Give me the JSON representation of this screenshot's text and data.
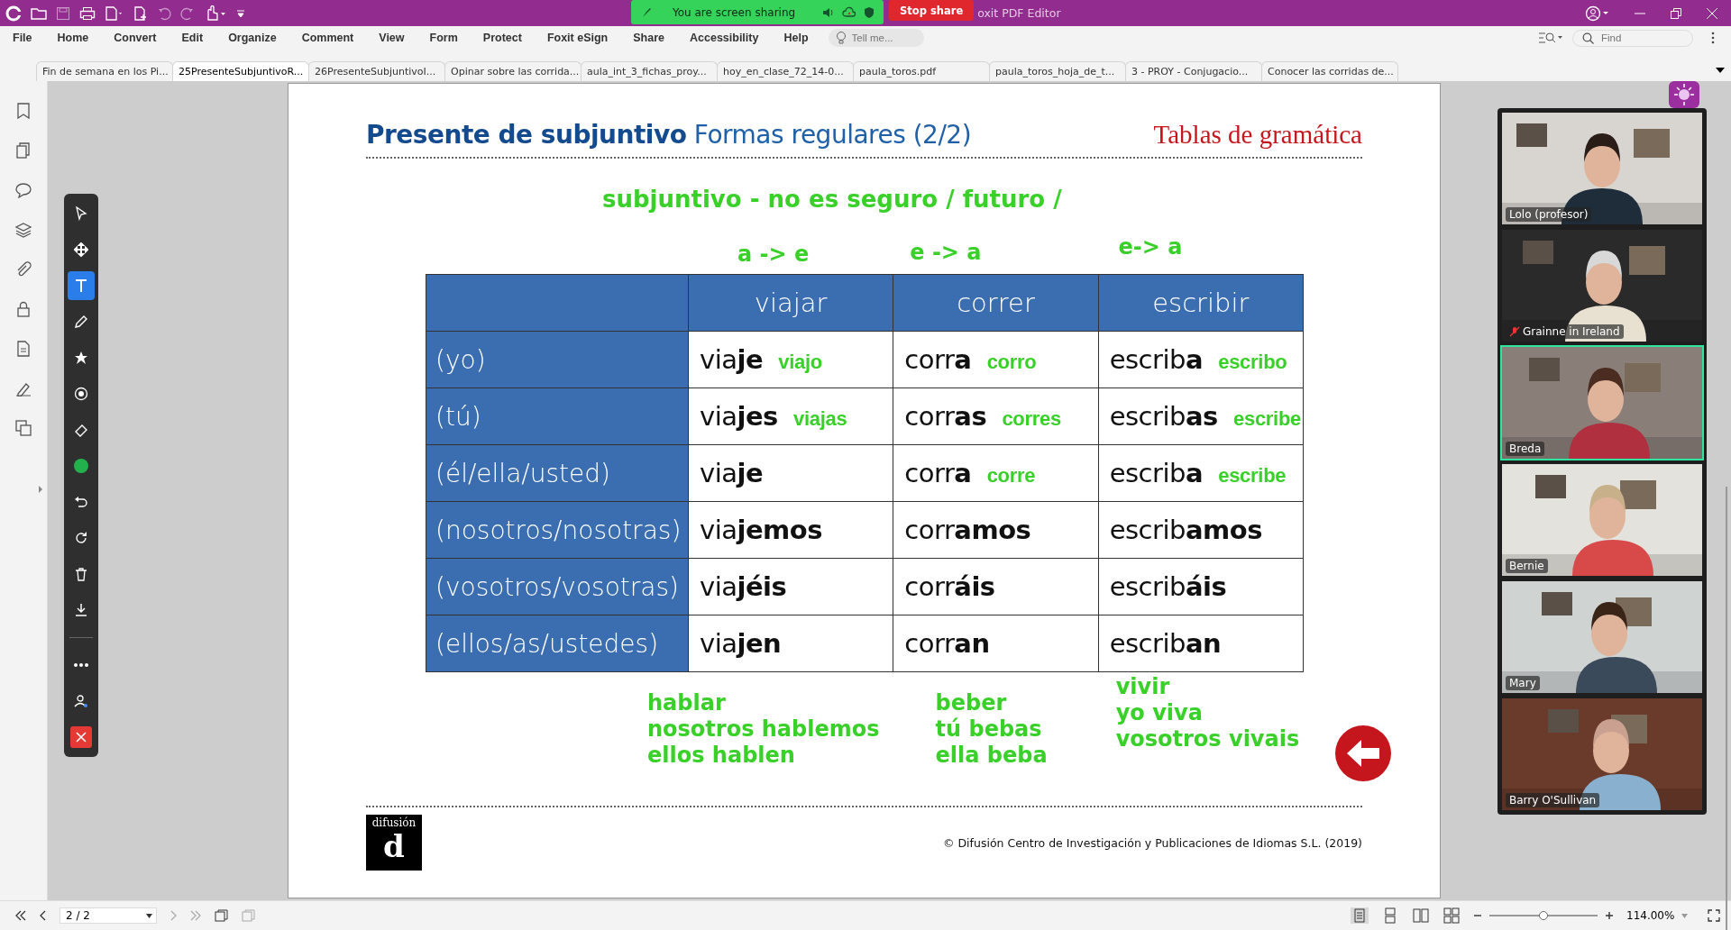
{
  "title_bar": {
    "sharing_status": "You are screen sharing",
    "stop_button": "Stop share",
    "app_title": "oxit PDF Editor"
  },
  "menu": [
    "File",
    "Home",
    "Convert",
    "Edit",
    "Organize",
    "Comment",
    "View",
    "Form",
    "Protect",
    "Foxit eSign",
    "Share",
    "Accessibility",
    "Help"
  ],
  "tell_me": {
    "placeholder": "Tell me..."
  },
  "find": {
    "placeholder": "Find"
  },
  "tabs": [
    {
      "label": "Fin de semana en los Pi...",
      "selected": false
    },
    {
      "label": "25PresenteSubjuntivoR...",
      "selected": true
    },
    {
      "label": "26PresenteSubjuntivoI...",
      "selected": false
    },
    {
      "label": "Opinar sobre las corrida...",
      "selected": false
    },
    {
      "label": "aula_int_3_fichas_proy...",
      "selected": false
    },
    {
      "label": "hoy_en_clase_72_14-0...",
      "selected": false
    },
    {
      "label": "paula_toros.pdf",
      "selected": false
    },
    {
      "label": "paula_toros_hoja_de_t...",
      "selected": false
    },
    {
      "label": "3 - PROY - Conjugacio...",
      "selected": false
    },
    {
      "label": "Conocer las corridas de...",
      "selected": false
    }
  ],
  "tools": [
    {
      "kind": "pointer",
      "selected": false
    },
    {
      "kind": "move",
      "selected": false
    },
    {
      "kind": "text",
      "selected": true
    },
    {
      "kind": "pencil",
      "selected": false
    },
    {
      "kind": "star",
      "selected": false
    },
    {
      "kind": "stamp",
      "selected": false
    },
    {
      "kind": "eraser",
      "selected": false
    },
    {
      "kind": "color",
      "selected": false,
      "color": "#22b14c"
    },
    {
      "kind": "undo",
      "selected": false
    },
    {
      "kind": "redo",
      "selected": false
    },
    {
      "kind": "delete",
      "selected": false
    },
    {
      "kind": "download",
      "selected": false
    },
    {
      "kind": "more",
      "selected": false
    },
    {
      "kind": "user",
      "selected": false
    },
    {
      "kind": "close",
      "selected": false
    }
  ],
  "document": {
    "title_bold": "Presente de subjuntivo",
    "title_rest": "Formas regulares (2/2)",
    "section": "Tablas de gramática",
    "note": "subjuntivo  - no es seguro / futuro /",
    "rules": [
      "a -> e",
      "e -> a",
      "e-> a"
    ],
    "table": {
      "columns": [
        "viajar",
        "correr",
        "escribir"
      ],
      "rows": [
        {
          "person": "(yo)",
          "cells": [
            {
              "form": "via**je**",
              "note": "viajo"
            },
            {
              "form": "corr**a**",
              "note": "corro"
            },
            {
              "form": "escrib**a**",
              "note": "escribo"
            }
          ]
        },
        {
          "person": "(tú)",
          "cells": [
            {
              "form": "via**jes**",
              "note": "viajas"
            },
            {
              "form": "corr**as**",
              "note": "corres"
            },
            {
              "form": "escrib**as**",
              "note": "escribe"
            }
          ]
        },
        {
          "person": "(él/ella/usted)",
          "cells": [
            {
              "form": "via**je**"
            },
            {
              "form": "corr**a**",
              "note": "corre"
            },
            {
              "form": "escrib**a**",
              "note": "escribe"
            }
          ]
        },
        {
          "person": "(nosotros/nosotras)",
          "cells": [
            {
              "form": "via**jemos**"
            },
            {
              "form": "corr**amos**"
            },
            {
              "form": "escrib**amos**"
            }
          ]
        },
        {
          "person": "(vosotros/vosotras)",
          "cells": [
            {
              "form": "via**jéis**"
            },
            {
              "form": "corr**áis**"
            },
            {
              "form": "escrib**áis**"
            }
          ]
        },
        {
          "person": "(ellos/as/ustedes)",
          "cells": [
            {
              "form": "via**jen**"
            },
            {
              "form": "corr**an**"
            },
            {
              "form": "escrib**an**"
            }
          ]
        }
      ]
    },
    "examples": [
      [
        "hablar",
        "nosotros hablemos",
        "ellos hablen"
      ],
      [
        "beber",
        "tú bebas",
        "ella beba"
      ],
      [
        "vivir",
        "yo viva",
        "vosotros vivais"
      ]
    ],
    "logo": {
      "name": "difusión",
      "letter": "d"
    },
    "copyright": "© Difusión Centro de Investigación y Publicaciones de Idiomas S.L. (2019)"
  },
  "participants": [
    {
      "name": "Lolo (profesor)",
      "muted": false,
      "selected": false
    },
    {
      "name": "Grainne in Ireland",
      "muted": true,
      "selected": false
    },
    {
      "name": "Breda",
      "muted": false,
      "selected": true
    },
    {
      "name": "Bernie",
      "muted": false,
      "selected": false
    },
    {
      "name": "Mary",
      "muted": false,
      "selected": false
    },
    {
      "name": "Barry O'Sullivan",
      "muted": false,
      "selected": false
    }
  ],
  "status_bar": {
    "page": "2 / 2",
    "zoom": "114.00%",
    "level": 0.5
  }
}
